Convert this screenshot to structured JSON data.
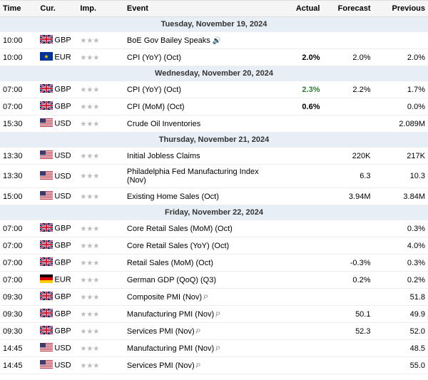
{
  "table": {
    "headers": [
      "Time",
      "Cur.",
      "Imp.",
      "Event",
      "Actual",
      "Forecast",
      "Previous"
    ],
    "sections": [
      {
        "label": "Tuesday, November 19, 2024",
        "rows": [
          {
            "time": "10:00",
            "currency": "GBP",
            "flag": "gbp",
            "stars": 3,
            "event": "BoE Gov Bailey Speaks",
            "sound": true,
            "preview": false,
            "actual": "",
            "actual_class": "",
            "forecast": "",
            "previous": ""
          },
          {
            "time": "10:00",
            "currency": "EUR",
            "flag": "eur",
            "stars": 3,
            "event": "CPI (YoY) (Oct)",
            "sound": false,
            "preview": false,
            "actual": "2.0%",
            "actual_class": "actual-black",
            "forecast": "2.0%",
            "previous": "2.0%"
          }
        ]
      },
      {
        "label": "Wednesday, November 20, 2024",
        "rows": [
          {
            "time": "07:00",
            "currency": "GBP",
            "flag": "gbp",
            "stars": 3,
            "event": "CPI (YoY) (Oct)",
            "sound": false,
            "preview": false,
            "actual": "2.3%",
            "actual_class": "actual-green",
            "forecast": "2.2%",
            "previous": "1.7%"
          },
          {
            "time": "07:00",
            "currency": "GBP",
            "flag": "gbp",
            "stars": 3,
            "event": "CPI (MoM) (Oct)",
            "sound": false,
            "preview": false,
            "actual": "0.6%",
            "actual_class": "actual-black",
            "forecast": "",
            "previous": "0.0%"
          },
          {
            "time": "15:30",
            "currency": "USD",
            "flag": "usd",
            "stars": 3,
            "event": "Crude Oil Inventories",
            "sound": false,
            "preview": false,
            "actual": "",
            "actual_class": "",
            "forecast": "",
            "previous": "2.089M"
          }
        ]
      },
      {
        "label": "Thursday, November 21, 2024",
        "rows": [
          {
            "time": "13:30",
            "currency": "USD",
            "flag": "usd",
            "stars": 3,
            "event": "Initial Jobless Claims",
            "sound": false,
            "preview": false,
            "actual": "",
            "actual_class": "",
            "forecast": "220K",
            "previous": "217K"
          },
          {
            "time": "13:30",
            "currency": "USD",
            "flag": "usd",
            "stars": 3,
            "event": "Philadelphia Fed Manufacturing Index (Nov)",
            "sound": false,
            "preview": false,
            "actual": "",
            "actual_class": "",
            "forecast": "6.3",
            "previous": "10.3"
          },
          {
            "time": "15:00",
            "currency": "USD",
            "flag": "usd",
            "stars": 3,
            "event": "Existing Home Sales (Oct)",
            "sound": false,
            "preview": false,
            "actual": "",
            "actual_class": "",
            "forecast": "3.94M",
            "previous": "3.84M"
          }
        ]
      },
      {
        "label": "Friday, November 22, 2024",
        "rows": [
          {
            "time": "07:00",
            "currency": "GBP",
            "flag": "gbp",
            "stars": 3,
            "event": "Core Retail Sales (MoM) (Oct)",
            "sound": false,
            "preview": false,
            "actual": "",
            "actual_class": "",
            "forecast": "",
            "previous": "0.3%"
          },
          {
            "time": "07:00",
            "currency": "GBP",
            "flag": "gbp",
            "stars": 3,
            "event": "Core Retail Sales (YoY) (Oct)",
            "sound": false,
            "preview": false,
            "actual": "",
            "actual_class": "",
            "forecast": "",
            "previous": "4.0%"
          },
          {
            "time": "07:00",
            "currency": "GBP",
            "flag": "gbp",
            "stars": 3,
            "event": "Retail Sales (MoM) (Oct)",
            "sound": false,
            "preview": false,
            "actual": "",
            "actual_class": "",
            "forecast": "-0.3%",
            "previous": "0.3%"
          },
          {
            "time": "07:00",
            "currency": "EUR",
            "flag": "de",
            "stars": 3,
            "event": "German GDP (QoQ) (Q3)",
            "sound": false,
            "preview": false,
            "actual": "",
            "actual_class": "",
            "forecast": "0.2%",
            "previous": "0.2%"
          },
          {
            "time": "09:30",
            "currency": "GBP",
            "flag": "gbp",
            "stars": 3,
            "event": "Composite PMI (Nov)",
            "sound": false,
            "preview": true,
            "actual": "",
            "actual_class": "",
            "forecast": "",
            "previous": "51.8"
          },
          {
            "time": "09:30",
            "currency": "GBP",
            "flag": "gbp",
            "stars": 3,
            "event": "Manufacturing PMI (Nov)",
            "sound": false,
            "preview": true,
            "actual": "",
            "actual_class": "",
            "forecast": "50.1",
            "previous": "49.9"
          },
          {
            "time": "09:30",
            "currency": "GBP",
            "flag": "gbp",
            "stars": 3,
            "event": "Services PMI (Nov)",
            "sound": false,
            "preview": true,
            "actual": "",
            "actual_class": "",
            "forecast": "52.3",
            "previous": "52.0"
          },
          {
            "time": "14:45",
            "currency": "USD",
            "flag": "usd",
            "stars": 3,
            "event": "Manufacturing PMI (Nov)",
            "sound": false,
            "preview": true,
            "actual": "",
            "actual_class": "",
            "forecast": "",
            "previous": "48.5"
          },
          {
            "time": "14:45",
            "currency": "USD",
            "flag": "usd",
            "stars": 3,
            "event": "Services PMI (Nov)",
            "sound": false,
            "preview": true,
            "actual": "",
            "actual_class": "",
            "forecast": "",
            "previous": "55.0"
          }
        ]
      }
    ]
  }
}
